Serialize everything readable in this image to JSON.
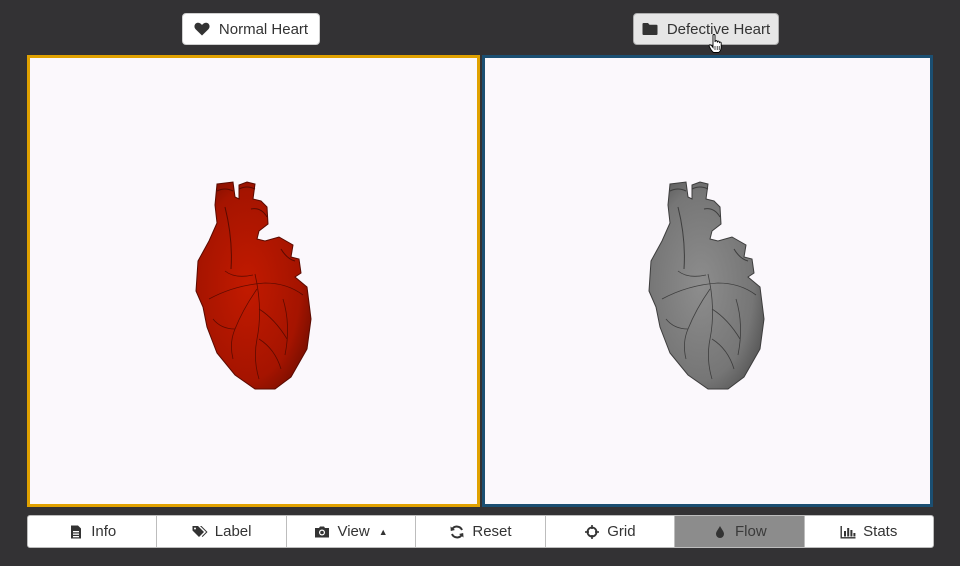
{
  "top_buttons": {
    "normal": {
      "label": "Normal Heart",
      "icon": "heart-icon"
    },
    "defective": {
      "label": "Defective Heart",
      "icon": "folder-icon"
    }
  },
  "viewports": {
    "left": {
      "border_color": "#e0a100",
      "model_color": "#c21a00"
    },
    "right": {
      "border_color": "#1b4f72",
      "model_color": "#7e7e7e"
    }
  },
  "toolbar": {
    "items": [
      {
        "label": "Info",
        "icon": "file-icon"
      },
      {
        "label": "Label",
        "icon": "tags-icon"
      },
      {
        "label": "View",
        "icon": "camera-icon",
        "dropdown": true
      },
      {
        "label": "Reset",
        "icon": "refresh-icon"
      },
      {
        "label": "Grid",
        "icon": "crosshair-icon"
      },
      {
        "label": "Flow",
        "icon": "drop-icon",
        "active": true
      },
      {
        "label": "Stats",
        "icon": "bar-chart-icon"
      }
    ]
  }
}
